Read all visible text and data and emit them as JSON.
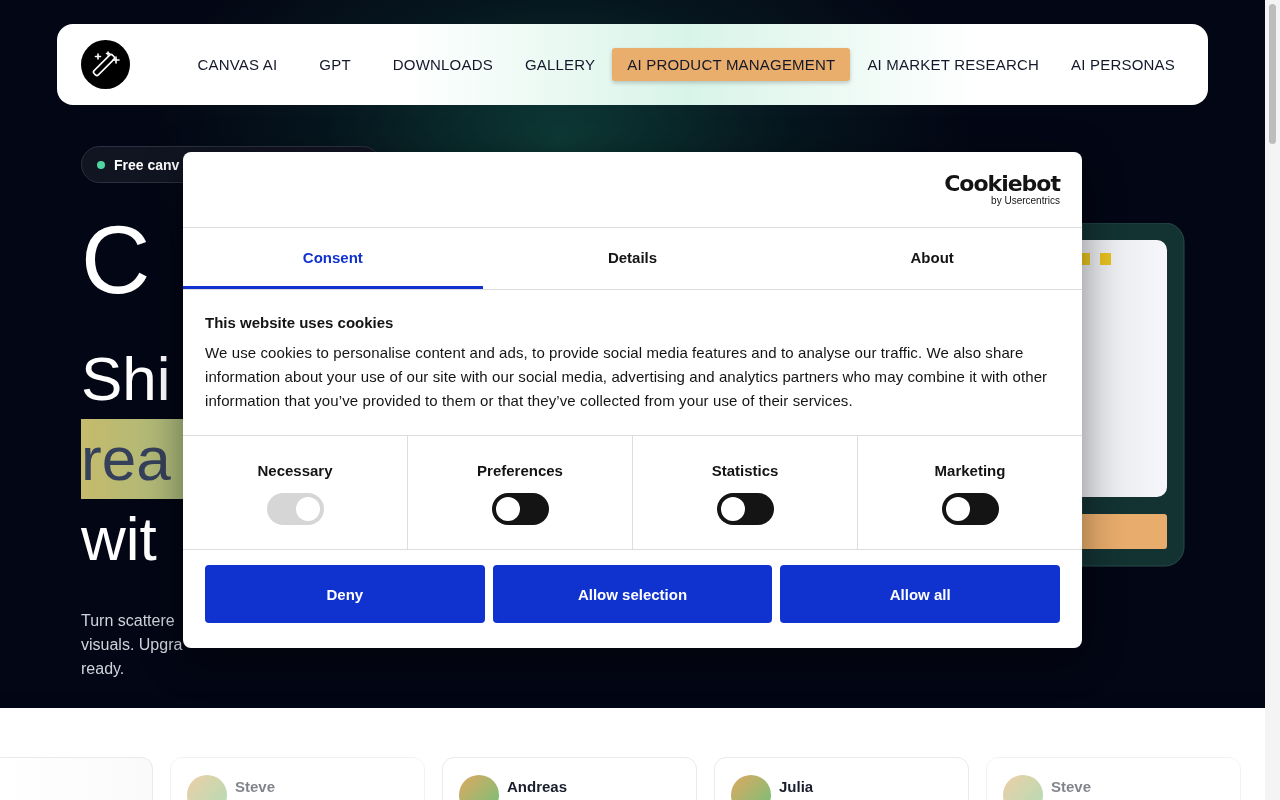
{
  "nav": {
    "items": [
      {
        "label": "CANVAS AI",
        "selected": false
      },
      {
        "label": "GPT",
        "selected": false
      },
      {
        "label": "DOWNLOADS",
        "selected": false
      },
      {
        "label": "GALLERY",
        "selected": false
      },
      {
        "label": "AI PRODUCT MANAGEMENT",
        "selected": true
      },
      {
        "label": "AI MARKET RESEARCH",
        "selected": false
      },
      {
        "label": "AI PERSONAS",
        "selected": false
      }
    ]
  },
  "hero": {
    "badge": "Free canv",
    "title": "C",
    "subtitle_lines": [
      {
        "text": "Shi",
        "highlighted": false
      },
      {
        "text": "rea",
        "highlighted": true
      },
      {
        "text": "wit",
        "highlighted": false
      }
    ],
    "description_lines": [
      "Turn scattere",
      "visuals. Upgra",
      "ready."
    ]
  },
  "cookie_dialog": {
    "brand": "Cookiebot",
    "brand_sub": "by Usercentrics",
    "tabs": [
      {
        "label": "Consent",
        "selected": true
      },
      {
        "label": "Details",
        "selected": false
      },
      {
        "label": "About",
        "selected": false
      }
    ],
    "heading": "This website uses cookies",
    "text": "We use cookies to personalise content and ads, to provide social media features and to analyse our traffic. We also share information about your use of our site with our social media, advertising and analytics partners who may combine it with other information that you’ve provided to them or that they’ve collected from your use of their services.",
    "categories": [
      {
        "label": "Necessary",
        "checked": true,
        "disabled": true
      },
      {
        "label": "Preferences",
        "checked": false,
        "disabled": false
      },
      {
        "label": "Statistics",
        "checked": false,
        "disabled": false
      },
      {
        "label": "Marketing",
        "checked": false,
        "disabled": false
      }
    ],
    "buttons": [
      "Deny",
      "Allow selection",
      "Allow all"
    ]
  },
  "testimonials": [
    {
      "name": "Steve",
      "faded": true
    },
    {
      "name": "Andreas",
      "faded": false
    },
    {
      "name": "Julia",
      "faded": false
    },
    {
      "name": "Steve",
      "faded": true
    }
  ]
}
